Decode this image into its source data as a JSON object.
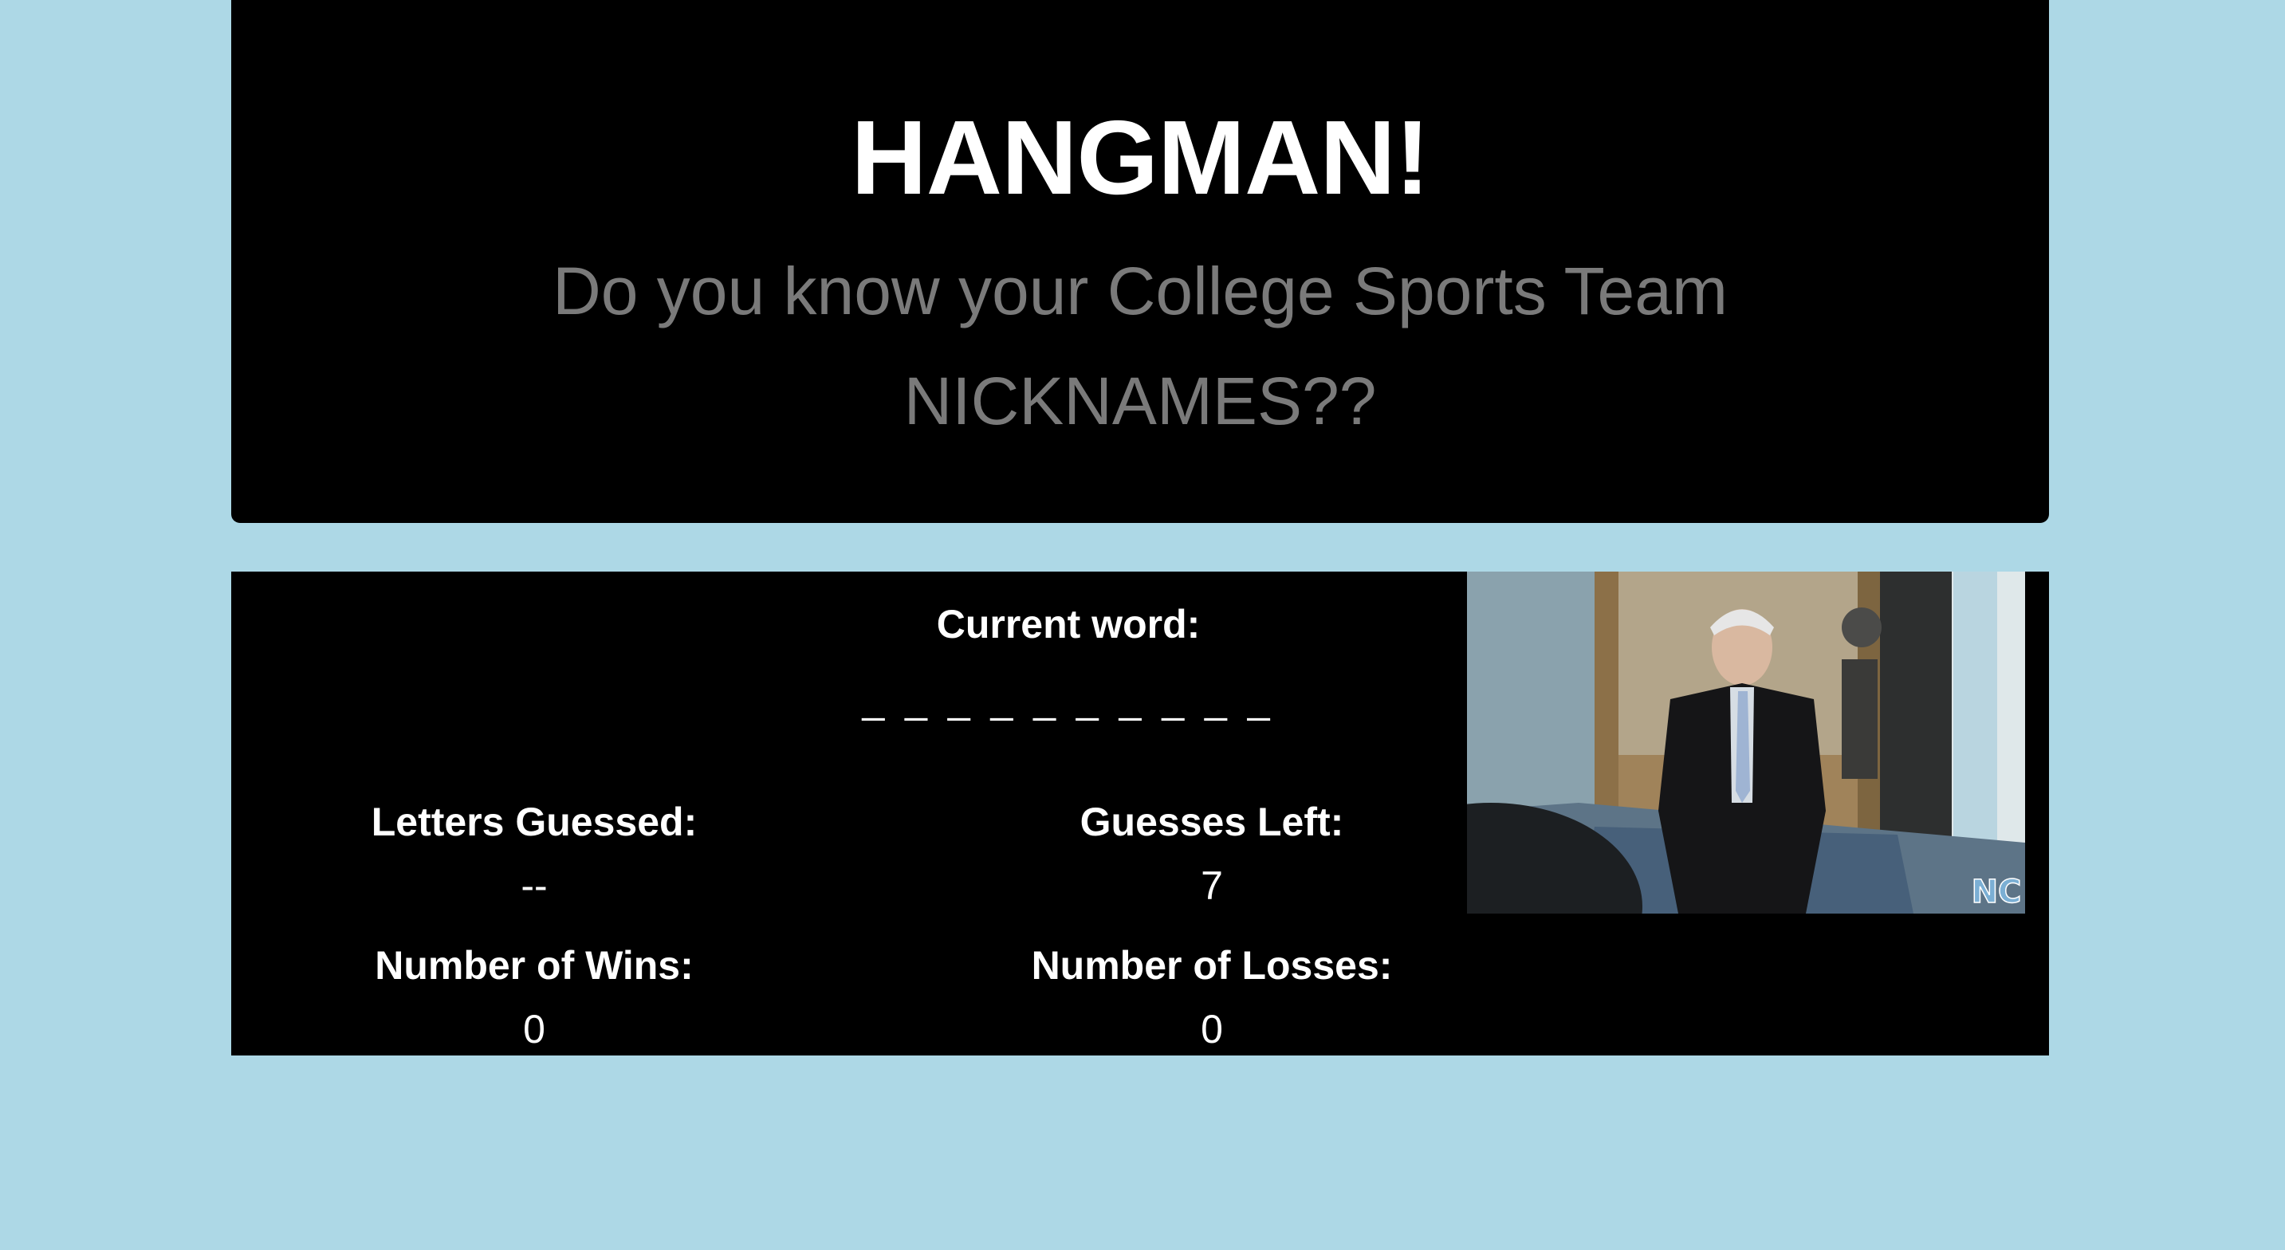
{
  "header": {
    "title": "HANGMAN!",
    "subtitle": "Do you know your College Sports Team NICKNAMES??"
  },
  "game": {
    "current_word_label": "Current word:",
    "current_word": "_ _ _ _ _ _ _ _ _ _",
    "letters_guessed_label": "Letters Guessed:",
    "letters_guessed": "--",
    "guesses_left_label": "Guesses Left:",
    "guesses_left": "7",
    "wins_label": "Number of Wins:",
    "wins": "0",
    "losses_label": "Number of Losses:",
    "losses": "0"
  },
  "media": {
    "icon": "unc-coach-gif",
    "logo_icon": "nc-logo-icon"
  },
  "colors": {
    "page_background": "#add8e6",
    "panel_background": "#000000",
    "title_text": "#ffffff",
    "subtitle_text": "#7a7a7a",
    "logo_blue": "#7bafd4"
  }
}
